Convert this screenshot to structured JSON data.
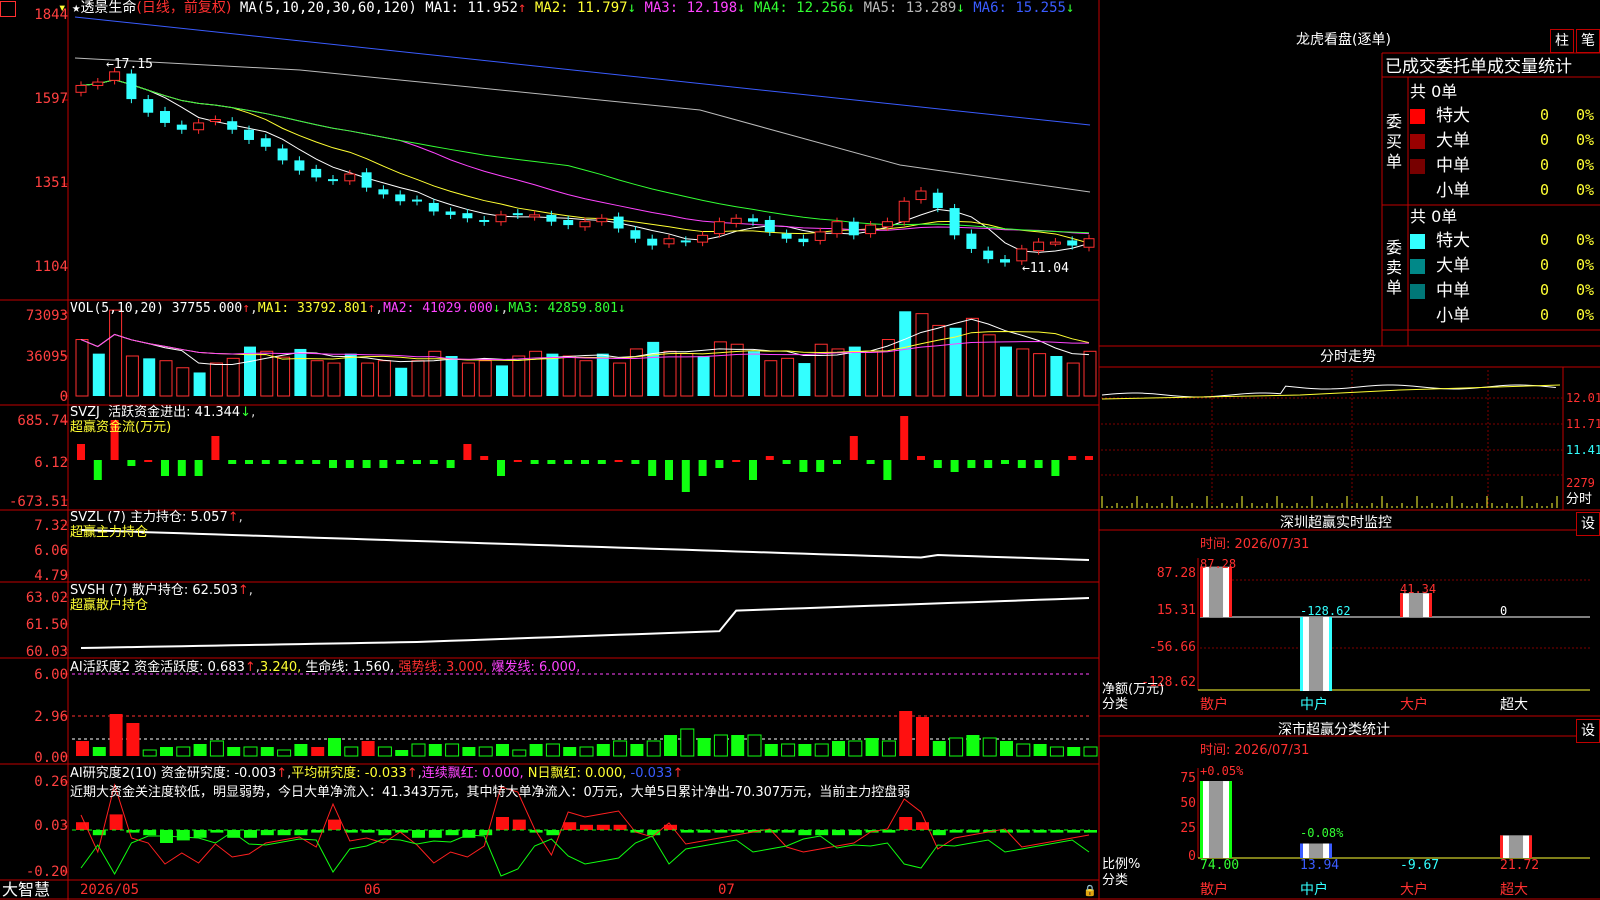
{
  "stock": {
    "name": "透景生命",
    "period": "(日线，前复权)"
  },
  "ma_line": {
    "label": "MA(5,10,20,30,60,120)",
    "items": [
      {
        "k": "MA1:",
        "v": "11.952",
        "arrow": "↑",
        "color": "#ffffff"
      },
      {
        "k": "MA2:",
        "v": "11.797",
        "arrow": "↓",
        "color": "#ffff33"
      },
      {
        "k": "MA3:",
        "v": "12.198",
        "arrow": "↓",
        "color": "#ff44ff"
      },
      {
        "k": "MA4:",
        "v": "12.256",
        "arrow": "↓",
        "color": "#33ff33"
      },
      {
        "k": "MA5:",
        "v": "13.289",
        "arrow": "↓",
        "color": "#bbbbbb"
      },
      {
        "k": "MA6:",
        "v": "15.255",
        "arrow": "↓",
        "color": "#3a5cff"
      }
    ]
  },
  "price_axis": [
    "1844",
    "1597",
    "1351",
    "1104"
  ],
  "price_marks": {
    "high": "17.15",
    "low": "11.04"
  },
  "vol": {
    "label": "VOL(5,10,20)",
    "value": "37755.000",
    "ma1": "MA1: 33792.801",
    "ma2": "MA2: 41029.000",
    "ma3": "MA3: 42859.801",
    "axis": [
      "73093",
      "36095",
      "0"
    ]
  },
  "svzj": {
    "label": "SVZJ",
    "title": "活跃资金进出: 41.344",
    "sub": "超赢资金流(万元)",
    "axis": [
      "685.74",
      "6.12",
      "-673.51"
    ]
  },
  "svzl": {
    "label": "SVZL (7)",
    "title": "主力持仓: 5.057",
    "sub": "超赢主力持仓",
    "axis": [
      "7.32",
      "6.06",
      "4.79"
    ]
  },
  "svsh": {
    "label": "SVSH (7)",
    "title": "散户持仓: 62.503",
    "sub": "超赢散户持仓",
    "axis": [
      "63.02",
      "61.50",
      "60.03"
    ]
  },
  "ai2": {
    "label": "AI活跃度2",
    "a": "资金活跃度: 0.683",
    "b": "3.240,",
    "c": "生命线: 1.560,",
    "d": "强势线: 3.000,",
    "e": "爆发线: 6.000,",
    "axis": [
      "6.00",
      "2.96",
      "0.00"
    ]
  },
  "ai_res": {
    "label": "AI研究度2(10)",
    "a": "资金研究度: -0.003",
    "b": "平均研究度: -0.033",
    "c": "连续飘红: 0.000,",
    "d": "N日飘红: 0.000,",
    "e": "-0.033",
    "axis": [
      "0.26",
      "0.03",
      "-0.20"
    ],
    "comment": "近期大资金关注度较低，明显弱势，今日大单净流入：41.343万元，其中特大单净流入：0万元，大单5日累计净出-70.307万元，当前主力控盘弱"
  },
  "dates": [
    "2026/05",
    "06",
    "07"
  ],
  "footer": {
    "brand": "大智慧"
  },
  "dragon": {
    "title": "龙虎看盘(逐单)",
    "btn1": "柱",
    "btn2": "笔",
    "header": "已成交委托单成交量统计",
    "buy": {
      "side": "委买单",
      "total": "共 0单",
      "rows": [
        {
          "n": "特大",
          "v": "0",
          "p": "0%"
        },
        {
          "n": "大单",
          "v": "0",
          "p": "0%"
        },
        {
          "n": "中单",
          "v": "0",
          "p": "0%"
        },
        {
          "n": "小单",
          "v": "0",
          "p": "0%"
        }
      ]
    },
    "sell": {
      "side": "委卖单",
      "total": "共 0单",
      "rows": [
        {
          "n": "特大",
          "v": "0",
          "p": "0%"
        },
        {
          "n": "大单",
          "v": "0",
          "p": "0%"
        },
        {
          "n": "中单",
          "v": "0",
          "p": "0%"
        },
        {
          "n": "小单",
          "v": "0",
          "p": "0%"
        }
      ]
    }
  },
  "intraday": {
    "title": "分时走势",
    "axis": [
      "12.01",
      "11.71",
      "11.41",
      "2279"
    ],
    "footer": "分时"
  },
  "sz_monitor": {
    "title": "深圳超赢实时监控",
    "btn": "设",
    "time": "时间: 2026/07/31",
    "axis": [
      "87.28",
      "15.31",
      "-56.66",
      "-128.62"
    ],
    "unit": "净额(万元)",
    "cat_label": "分类",
    "categories": [
      "散户",
      "中户",
      "大户",
      "超大"
    ],
    "values": [
      "87.28",
      "-128.62",
      "41.34",
      "0"
    ]
  },
  "sz_class": {
    "title": "深市超赢分类统计",
    "btn": "设",
    "time": "时间: 2026/07/31",
    "axis": [
      "75",
      "50",
      "25",
      "0"
    ],
    "unit": "比例%",
    "cat_label": "分类",
    "categories": [
      "散户",
      "中户",
      "大户",
      "超大"
    ],
    "top_labels": [
      "+0.05%",
      "-0.08%",
      "",
      ""
    ],
    "values": [
      "74.00",
      "13.94",
      "-9.67",
      "21.72"
    ]
  },
  "chart_data": [
    {
      "type": "candlestick",
      "title": "透景生命 (日线，前复权)",
      "ylim": [
        11.04,
        18.44
      ],
      "x": [
        "2026/05",
        "06",
        "07"
      ],
      "close": [
        16.4,
        16.5,
        16.8,
        16.0,
        15.6,
        15.3,
        15.1,
        15.3,
        15.4,
        15.1,
        14.8,
        14.6,
        14.2,
        13.9,
        13.7,
        13.6,
        13.8,
        13.4,
        13.2,
        13.0,
        13.0,
        12.7,
        12.6,
        12.5,
        12.4,
        12.6,
        12.6,
        12.6,
        12.4,
        12.3,
        12.4,
        12.5,
        12.2,
        11.9,
        11.7,
        11.9,
        11.8,
        12.0,
        12.4,
        12.5,
        12.4,
        12.1,
        11.9,
        11.8,
        12.1,
        12.4,
        12.0,
        12.3,
        12.4,
        13.0,
        13.3,
        12.8,
        12.0,
        11.6,
        11.3,
        11.2,
        11.6,
        11.8,
        11.8,
        11.7,
        11.9
      ],
      "volume": [
        48,
        36,
        73,
        34,
        32,
        30,
        24,
        20,
        28,
        32,
        42,
        38,
        33,
        40,
        30,
        28,
        36,
        28,
        30,
        24,
        30,
        38,
        34,
        28,
        30,
        26,
        34,
        38,
        36,
        34,
        30,
        36,
        28,
        40,
        46,
        38,
        36,
        34,
        46,
        44,
        38,
        30,
        32,
        28,
        44,
        40,
        42,
        38,
        48,
        72,
        70,
        60,
        58,
        66,
        52,
        42,
        40,
        36,
        34,
        28,
        38
      ]
    }
  ]
}
